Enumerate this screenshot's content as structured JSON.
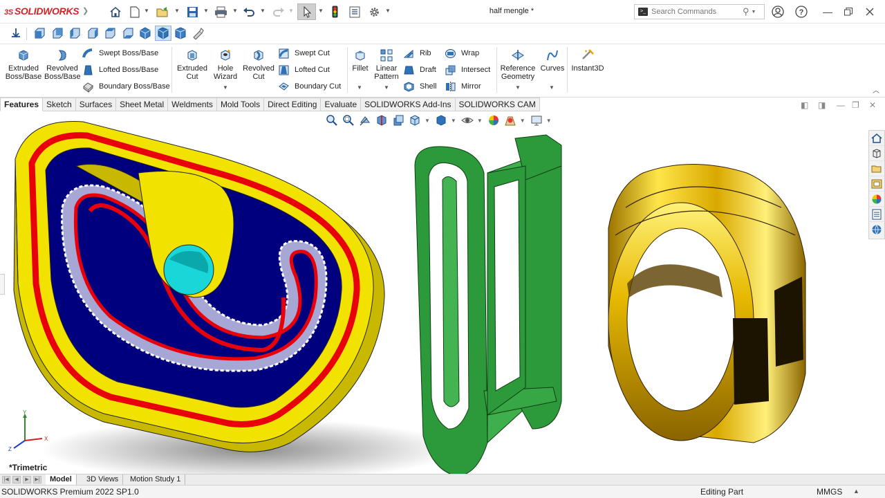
{
  "app": {
    "logo_prefix": "3S",
    "logo": "SOLIDWORKS"
  },
  "document": {
    "title": "half mengle *"
  },
  "search": {
    "placeholder": "Search Commands"
  },
  "ribbon": {
    "extruded_boss": "Extruded Boss/Base",
    "revolved_boss": "Revolved Boss/Base",
    "swept_boss": "Swept Boss/Base",
    "lofted_boss": "Lofted Boss/Base",
    "boundary_boss": "Boundary Boss/Base",
    "extruded_cut": "Extruded Cut",
    "hole_wizard": "Hole Wizard",
    "revolved_cut": "Revolved Cut",
    "swept_cut": "Swept Cut",
    "lofted_cut": "Lofted Cut",
    "boundary_cut": "Boundary Cut",
    "fillet": "Fillet",
    "linear_pattern": "Linear Pattern",
    "rib": "Rib",
    "draft": "Draft",
    "shell": "Shell",
    "wrap": "Wrap",
    "intersect": "Intersect",
    "mirror": "Mirror",
    "reference_geometry": "Reference Geometry",
    "curves": "Curves",
    "instant3d": "Instant3D"
  },
  "tabs": [
    "Features",
    "Sketch",
    "Surfaces",
    "Sheet Metal",
    "Weldments",
    "Mold Tools",
    "Direct Editing",
    "Evaluate",
    "SOLIDWORKS Add-Ins",
    "SOLIDWORKS CAM"
  ],
  "viewport": {
    "view_name": "*Trimetric",
    "triad_x": "X",
    "triad_y": "Y",
    "triad_z": "Z"
  },
  "bottom_tabs": [
    "Model",
    "3D Views",
    "Motion Study 1"
  ],
  "status": {
    "product": "SOLIDWORKS Premium 2022 SP1.0",
    "mode": "Editing Part",
    "units": "MMGS"
  },
  "colors": {
    "brand": "#d2232a",
    "part1_yellow": "#f2e200",
    "part1_blue": "#00007f",
    "part1_red": "#e8000a",
    "gear_lilac": "#a7a7d6",
    "hole_cyan": "#19d6d9",
    "part2_green": "#2c9a3a",
    "part3_gold": "#e1b400"
  },
  "icons": [
    "home-icon",
    "new-document-icon",
    "open-icon",
    "save-icon",
    "print-icon",
    "undo-icon",
    "redo-icon",
    "select-icon",
    "rebuild-icon",
    "file-properties-icon",
    "options-icon",
    "search-icon",
    "user-icon",
    "help-icon"
  ]
}
